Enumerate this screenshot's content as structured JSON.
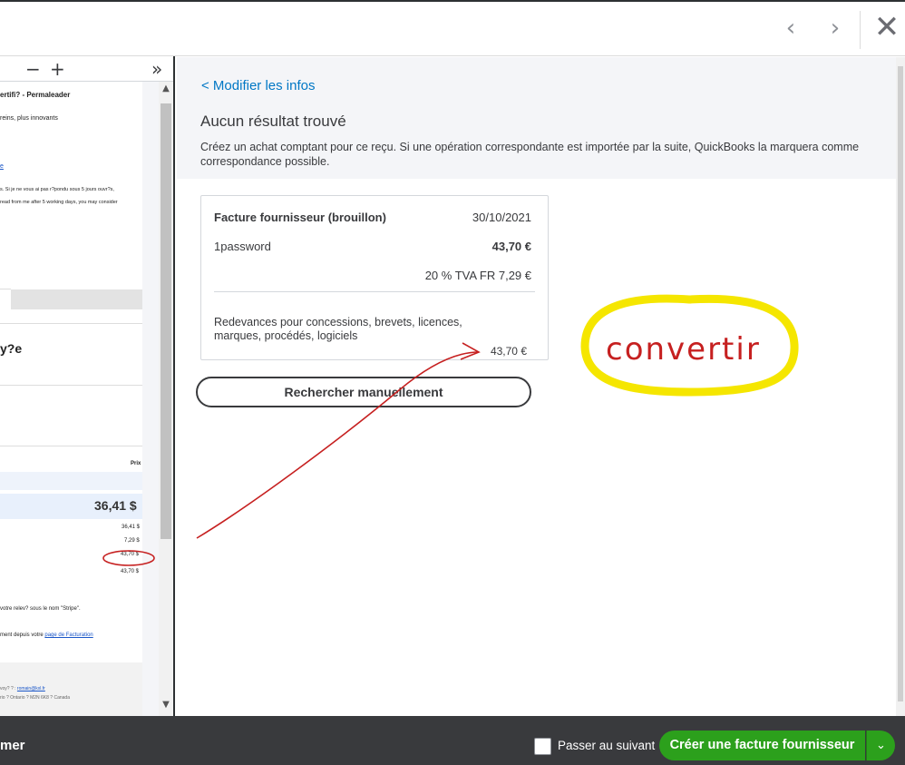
{
  "topbar": {
    "prev_icon": "‹",
    "next_icon": "›",
    "close_icon": "✕"
  },
  "preview": {
    "toolbar": {
      "minus": "−",
      "plus": "+",
      "expand": "»"
    },
    "lines": [
      "ertifi? - Permaleader",
      "reins, plus innovants",
      "e",
      "s. Si je ne vous ai pas r?pondu sous 5 jours ouvr?s,",
      "read from me after 5 working days, you may consider",
      "y?e",
      "Prix",
      "36,41 $",
      "36,41 $",
      "7,29 $",
      "43,70 $",
      "43,70 $",
      "votre relev? sous le nom \"Stripe\".",
      "ment depuis votre",
      "page de Facturation",
      "voy? ? :",
      "romain@kxl.fr",
      "rio ? Ontario ? M2N 6K8 ? Canada"
    ]
  },
  "panel": {
    "back_link": "< Modifier les infos",
    "title": "Aucun résultat trouvé",
    "description": "Créez un achat comptant pour ce reçu. Si une opération correspondante est importée par la suite, QuickBooks la marquera comme correspondance possible.",
    "card": {
      "type": "Facture fournisseur (brouillon)",
      "date": "30/10/2021",
      "vendor": "1password",
      "amount": "43,70 €",
      "tax": "20 % TVA FR 7,29 €",
      "category": "Redevances pour concessions, brevets, licences, marques, procédés, logiciels",
      "line_amount": "43,70 €"
    },
    "search_button": "Rechercher manuellement"
  },
  "annotation": {
    "text": "convertir",
    "highlight_color": "#f5e600",
    "stroke_color": "#c62020"
  },
  "footer": {
    "left_label": "mer",
    "checkbox_label": "Passer au suivant",
    "create_button": "Créer une facture fournisseur",
    "caret": "⌄",
    "accent": "#2ca01c"
  }
}
